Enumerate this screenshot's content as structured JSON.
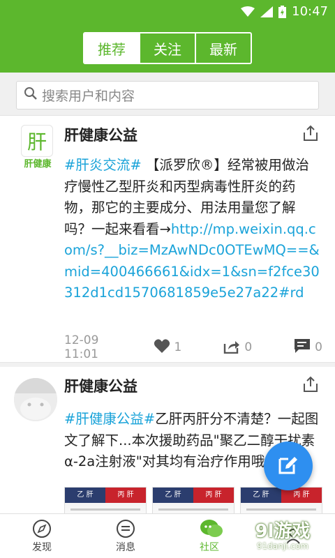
{
  "status_bar": {
    "time": "10:47",
    "icons": [
      "wifi-icon",
      "signal-icon",
      "battery-icon"
    ]
  },
  "tabs": [
    {
      "label": "推荐",
      "active": true
    },
    {
      "label": "关注",
      "active": false
    },
    {
      "label": "最新",
      "active": false
    }
  ],
  "search": {
    "placeholder": "搜索用户和内容"
  },
  "posts": [
    {
      "avatar_glyph": "肝",
      "avatar_caption": "肝健康",
      "name": "肝健康公益",
      "tag": "#肝炎交流#",
      "text": " 【派罗欣®】经常被用做治疗慢性乙型肝炎和丙型病毒性肝炎的药物，那它的主要成分、用法用量您了解吗？一起来看看→",
      "link": "http://mp.weixin.qq.com/s?__biz=MzAwNDc0OTEwMQ==&mid=400466661&idx=1&sn=f2fce30312d1cd1570681859e5e27a22#rd",
      "time": "12-09 11:01",
      "likes": "1",
      "reposts": "0",
      "comments": "0"
    },
    {
      "name": "肝健康公益",
      "tag": "#肝健康公益#",
      "text": "乙肝丙肝分不清楚？一起图文了解下...本次援助药品\"聚乙二醇干扰素α-2a注射液\"对其均有治疗作用哦",
      "thumbs": [
        {
          "left": "乙 肝",
          "right": "丙 肝"
        },
        {
          "left": "乙 肝",
          "right": "丙 肝"
        },
        {
          "left": "乙 肝",
          "right": "丙 肝"
        }
      ]
    }
  ],
  "bottom_nav": [
    {
      "label": "发现",
      "icon": "compass-icon",
      "active": false
    },
    {
      "label": "消息",
      "icon": "message-icon",
      "active": false
    },
    {
      "label": "社区",
      "icon": "community-icon",
      "active": true
    },
    {
      "label": "",
      "icon": "profile-icon",
      "active": false
    }
  ],
  "watermark": {
    "main": "9l游戏",
    "sub": "91danji.com"
  },
  "colors": {
    "brand_green": "#5cb72d",
    "link_blue": "#1aa3d9",
    "fab_blue": "#2e8ff0"
  }
}
